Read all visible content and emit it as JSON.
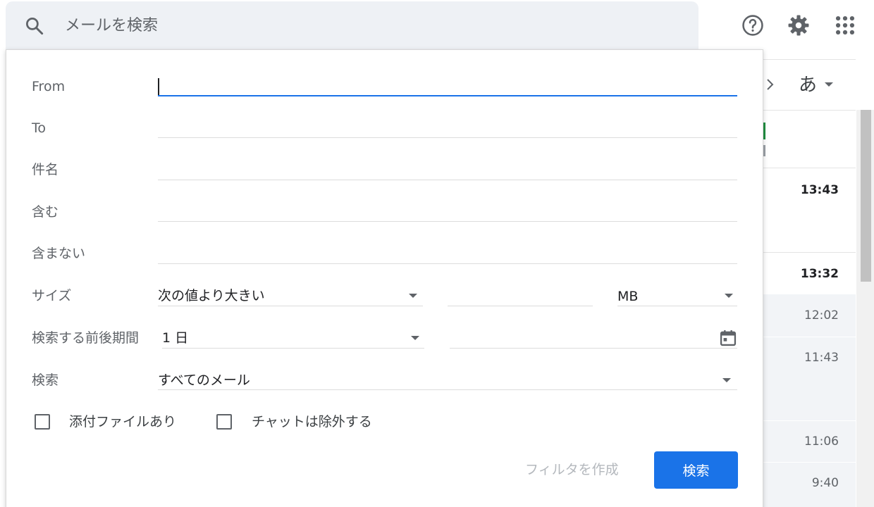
{
  "search": {
    "placeholder": "メールを検索"
  },
  "header_icons": [
    "help-icon",
    "gear-icon",
    "apps-icon"
  ],
  "background_list": {
    "language_label": "あ",
    "times": [
      {
        "value": "13:43",
        "bold": true
      },
      {
        "value": "13:32",
        "bold": true
      },
      {
        "value": "12:02",
        "bold": false
      },
      {
        "value": "11:43",
        "bold": false
      },
      {
        "value": "11:06",
        "bold": false
      },
      {
        "value": "9:40",
        "bold": false
      }
    ]
  },
  "search_panel": {
    "fields": {
      "from": {
        "label": "From",
        "value": ""
      },
      "to": {
        "label": "To",
        "value": ""
      },
      "subject": {
        "label": "件名",
        "value": ""
      },
      "has_words": {
        "label": "含む",
        "value": ""
      },
      "excludes": {
        "label": "含まない",
        "value": ""
      }
    },
    "size": {
      "label": "サイズ",
      "operator": "次の値より大きい",
      "value": "",
      "unit": "MB"
    },
    "date_within": {
      "label": "検索する前後期間",
      "range": "1 日",
      "date": ""
    },
    "search_in": {
      "label": "検索",
      "value": "すべてのメール"
    },
    "checkboxes": {
      "has_attachment": {
        "label": "添付ファイルあり",
        "checked": false
      },
      "exclude_chats": {
        "label": "チャットは除外する",
        "checked": false
      }
    },
    "actions": {
      "create_filter": "フィルタを作成",
      "search": "検索"
    }
  },
  "colors": {
    "primary": "#1a73e8",
    "search_bg": "#eef1f5",
    "disabled_text": "#b4b8bd"
  }
}
